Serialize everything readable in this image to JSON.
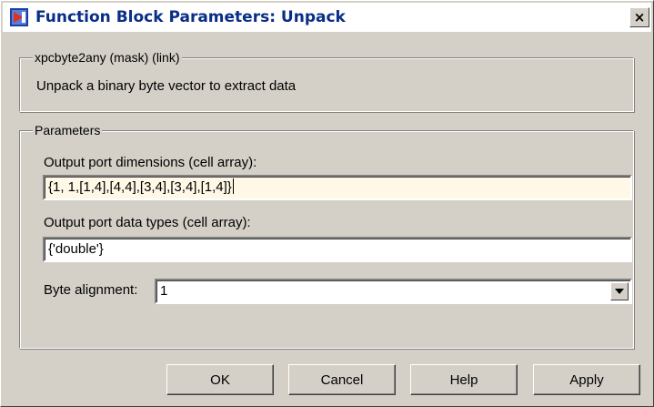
{
  "window": {
    "title": "Function Block Parameters: Unpack",
    "close_glyph": "×"
  },
  "mask_group": {
    "legend": "xpcbyte2any (mask) (link)",
    "description": "Unpack a binary byte vector to extract data"
  },
  "params_group": {
    "legend": "Parameters",
    "dims_label": "Output port dimensions (cell array):",
    "dims_value": "{1, 1,[1,4],[4,4],[3,4],[3,4],[1,4]}",
    "types_label": "Output port data types (cell array):",
    "types_value": "{'double'}",
    "align_label": "Byte alignment:",
    "align_value": "1"
  },
  "buttons": {
    "ok": "OK",
    "cancel": "Cancel",
    "help": "Help",
    "apply": "Apply"
  },
  "icons": {
    "app": "simulink-block-icon",
    "dropdown": "triangle-down-icon"
  },
  "colors": {
    "title_text": "#0a2e87",
    "active_field_bg": "#fff8e6",
    "dialog_bg": "#d4d0c8"
  }
}
